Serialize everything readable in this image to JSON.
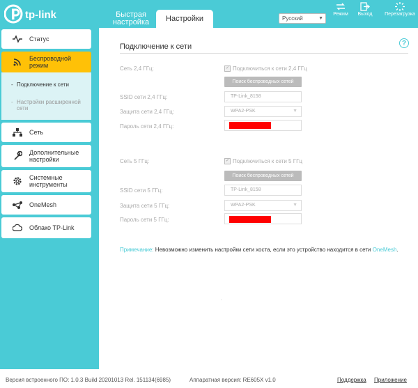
{
  "header": {
    "logo_text": "tp-link",
    "tab_quick": "Быстрая настройка",
    "tab_settings": "Настройки",
    "language": "Русский",
    "btn_mode": "Режим",
    "btn_logout": "Выход",
    "btn_reboot": "Перезагрузка"
  },
  "sidebar": {
    "items": [
      {
        "label": "Статус"
      },
      {
        "label": "Беспроводной режим"
      },
      {
        "label": "Сеть"
      },
      {
        "label": "Дополнительные настройки"
      },
      {
        "label": "Системные инструменты"
      },
      {
        "label": "OneMesh"
      },
      {
        "label": "Облако TP-Link"
      }
    ],
    "sub_items": [
      {
        "label": "Подключение к сети"
      },
      {
        "label": "Настройки расширенной сети"
      }
    ]
  },
  "main": {
    "title": "Подключение к сети",
    "band24": {
      "label": "Сеть 2,4 ГГц:",
      "checkbox": "Подключиться к сети 2,4 ГГц",
      "scan_btn": "Поиск беспроводных сетей",
      "ssid_label": "SSID сети 2,4 ГГц:",
      "ssid_value": "TP-Link_8158",
      "security_label": "Защита сети 2,4 ГГц:",
      "security_value": "WPA2-PSK",
      "password_label": "Пароль сети 2,4 ГГц:"
    },
    "band5": {
      "label": "Сеть 5 ГГц:",
      "checkbox": "Подключиться к сети 5 ГГц",
      "scan_btn": "Поиск беспроводных сетей",
      "ssid_label": "SSID сети 5 ГГц:",
      "ssid_value": "TP-Link_8158",
      "security_label": "Защита сети 5 ГГц:",
      "security_value": "WPA2-PSK",
      "password_label": "Пароль сети 5 ГГц:"
    },
    "note_label": "Примечание:",
    "note_text": "Невозможно изменить настройки сети хоста, если это устройство находится в сети",
    "note_link": "OneMesh",
    "note_end": "."
  },
  "footer": {
    "firmware": "Версия встроенного ПО: 1.0.3 Build 20201013 Rel. 151134(6985)",
    "hardware": "Аппаратная версия: RE605X v1.0",
    "support": "Поддержка",
    "app": "Приложение"
  },
  "colors": {
    "accent": "#4acbd6",
    "active": "#ffc107",
    "redaction": "#ff0000"
  }
}
